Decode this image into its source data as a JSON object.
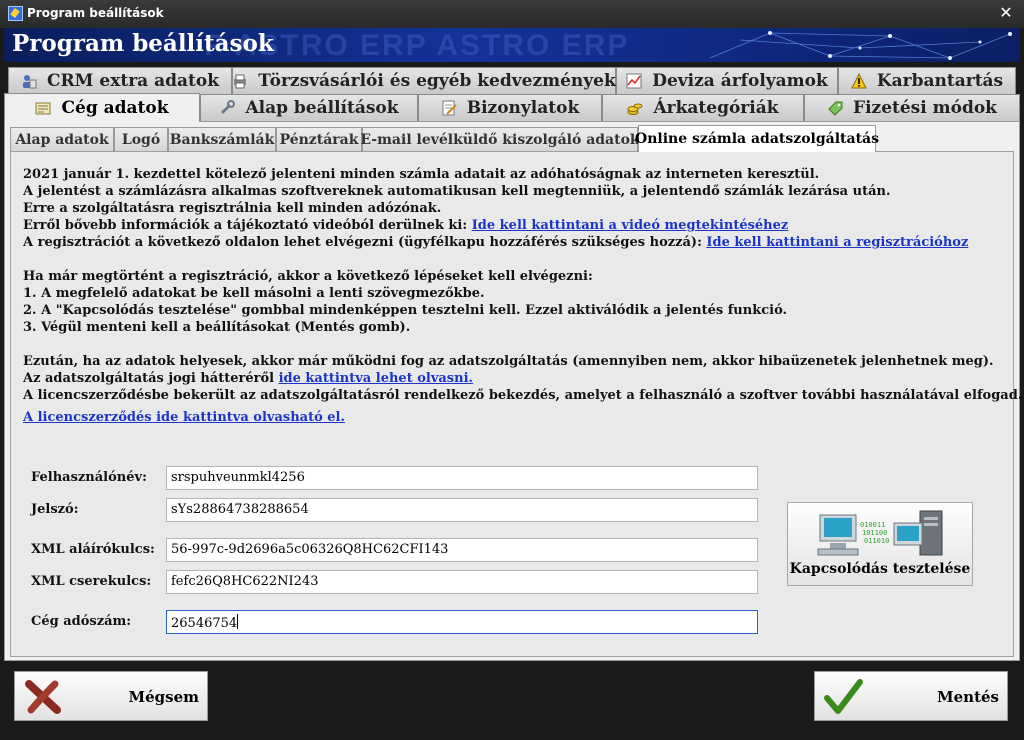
{
  "window": {
    "title": "Program beállítások"
  },
  "banner": {
    "title": "Program beállítások",
    "watermark": "P     ASTRO ERP     ASTRO ERP"
  },
  "outer_tabs_row1": [
    {
      "label": "CRM extra adatok",
      "icon": "user-card-icon"
    },
    {
      "label": "Törzsvásárlói és egyéb kedvezmények",
      "icon": "printer-icon"
    },
    {
      "label": "Deviza árfolyamok",
      "icon": "chart-icon"
    },
    {
      "label": "Karbantartás",
      "icon": "warning-icon"
    }
  ],
  "outer_tabs_row2": [
    {
      "label": "Cég adatok",
      "icon": "company-doc-icon",
      "active": true
    },
    {
      "label": "Alap beállítások",
      "icon": "wrench-icon"
    },
    {
      "label": "Bizonylatok",
      "icon": "document-edit-icon"
    },
    {
      "label": "Árkategóriák",
      "icon": "coins-icon"
    },
    {
      "label": "Fizetési módok",
      "icon": "payment-tag-icon"
    }
  ],
  "inner_tabs": [
    {
      "label": "Alap adatok"
    },
    {
      "label": "Logó"
    },
    {
      "label": "Bankszámlák"
    },
    {
      "label": "Pénztárak"
    },
    {
      "label": "E-mail levélküldő kiszolgáló adatok"
    },
    {
      "label": "Online számla adatszolgáltatás",
      "active": true
    }
  ],
  "info": {
    "line1": "2021 január 1. kezdettel kötelező jelenteni minden számla adatait az adóhatóságnak az interneten keresztül.",
    "line2": "A jelentést a számlázásra alkalmas szoftvereknek automatikusan kell megtenniük, a jelentendő számlák lezárása után.",
    "line3": "Erre a szolgáltatásra regisztrálnia kell minden adózónak.",
    "line4_text": "Erről bővebb információk a tájékoztató videóból derülnek ki:",
    "line4_link": "Ide kell kattintani a videó megtekintéséhez",
    "line5_text": "A regisztrációt a következő oldalon lehet elvégezni (ügyfélkapu hozzáférés szükséges hozzá):",
    "line5_link": "Ide kell kattintani a regisztrációhoz",
    "steps_intro": "Ha már megtörtént a regisztráció, akkor a következő lépéseket kell elvégezni:",
    "step1": " 1. A megfelelő adatokat be kell másolni a lenti szövegmezőkbe.",
    "step2": " 2. A \"Kapcsolódás tesztelése\" gombbal mindenképpen tesztelni kell. Ezzel aktiválódik a jelentés funkció.",
    "step3": " 3. Végül menteni kell a beállításokat (Mentés gomb).",
    "after1": "Ezután, ha az adatok helyesek, akkor már működni fog az adatszolgáltatás (amennyiben nem, akkor hibaüzenetek jelenhetnek meg).",
    "after2_text": "Az adatszolgáltatás jogi hátteréről",
    "after2_link": "ide kattintva lehet olvasni.",
    "after3": "A licencszerződésbe bekerült az adatszolgáltatásról rendelkező bekezdés, amelyet a felhasználó a szoftver további használatával elfogad.",
    "license_link": "A licencszerződés ide kattintva olvasható el."
  },
  "fields": {
    "username": {
      "label": "Felhasználónév:",
      "value": "srspuhveunmkl4256"
    },
    "password": {
      "label": "Jelszó:",
      "value": "sYs28864738288654"
    },
    "signing_key": {
      "label": "XML aláírókulcs:",
      "value": "56-997c-9d2696a5c06326Q8HC62CFI143"
    },
    "exchange_key": {
      "label": "XML cserekulcs:",
      "value": "fefc26Q8HC622NI243"
    },
    "tax_number": {
      "label": "Cég adószám:",
      "value": "26546754"
    }
  },
  "test_button": {
    "label": "Kapcsolódás tesztelése",
    "icon": "network-computers-icon"
  },
  "buttons": {
    "cancel": "Mégsem",
    "save": "Mentés"
  }
}
